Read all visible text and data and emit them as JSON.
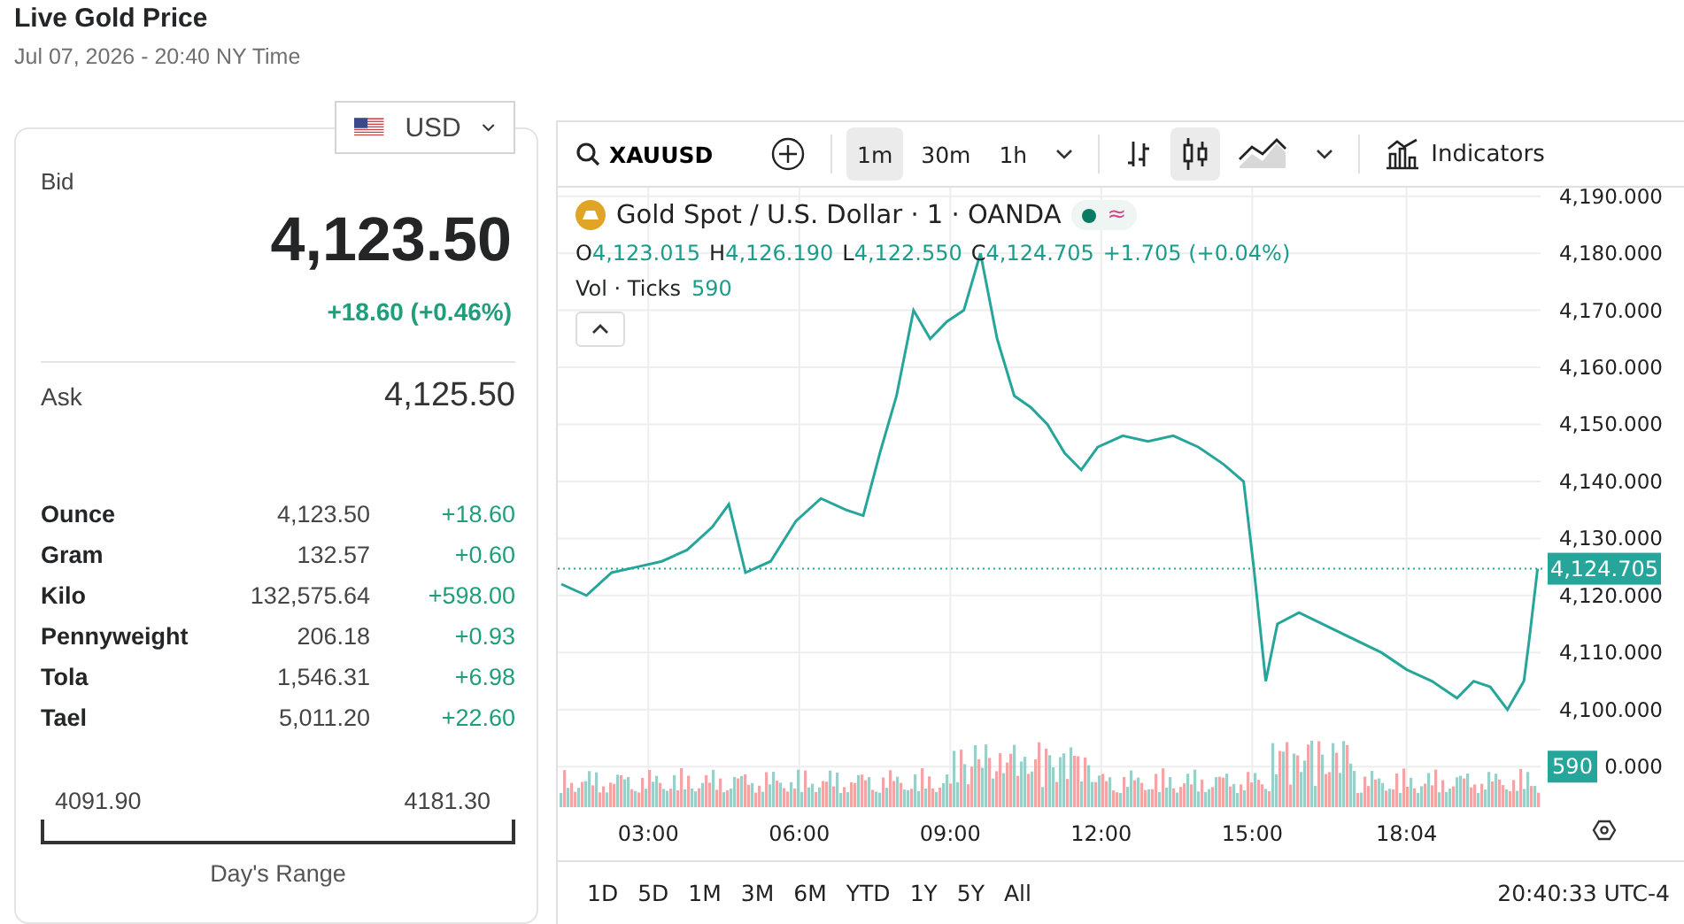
{
  "header": {
    "title": "Live Gold Price",
    "timestamp": "Jul 07, 2026 - 20:40 NY Time"
  },
  "currency": {
    "code": "USD"
  },
  "quote": {
    "bid_label": "Bid",
    "bid": "4,123.50",
    "change": "+18.60 (+0.46%)",
    "ask_label": "Ask",
    "ask": "4,125.50"
  },
  "units": [
    {
      "unit": "Ounce",
      "price": "4,123.50",
      "change": "+18.60"
    },
    {
      "unit": "Gram",
      "price": "132.57",
      "change": "+0.60"
    },
    {
      "unit": "Kilo",
      "price": "132,575.64",
      "change": "+598.00"
    },
    {
      "unit": "Pennyweight",
      "price": "206.18",
      "change": "+0.93"
    },
    {
      "unit": "Tola",
      "price": "1,546.31",
      "change": "+6.98"
    },
    {
      "unit": "Tael",
      "price": "5,011.20",
      "change": "+22.60"
    }
  ],
  "day_range": {
    "low": "4091.90",
    "high": "4181.30",
    "label": "Day's Range"
  },
  "chart": {
    "toolbar": {
      "symbol": "XAUUSD",
      "intervals": [
        {
          "label": "1m",
          "selected": true
        },
        {
          "label": "30m",
          "selected": false
        },
        {
          "label": "1h",
          "selected": false
        }
      ],
      "chart_types": [
        {
          "kind": "bars",
          "selected": false
        },
        {
          "kind": "candles",
          "selected": true
        },
        {
          "kind": "area",
          "selected": false
        }
      ],
      "indicators": "Indicators"
    },
    "legend": {
      "title": "Gold Spot / U.S. Dollar · 1 · OANDA",
      "status": "≈",
      "ohlc": [
        {
          "key": "O",
          "value": "4,123.015"
        },
        {
          "key": "H",
          "value": "4,126.190"
        },
        {
          "key": "L",
          "value": "4,122.550"
        },
        {
          "key": "C",
          "value": "4,124.705"
        }
      ],
      "change": "+1.705 (+0.04%)",
      "volume_label": "Vol · Ticks",
      "volume": "590"
    },
    "last_price": "4,124.705",
    "last_volume": "590",
    "covered_tick_label": "0.000",
    "chart_data": {
      "type": "line",
      "grid": true,
      "xlim": [
        1.2,
        20.8
      ],
      "ylim": [
        4082.9,
        4191.5
      ],
      "ref_lines": [
        {
          "axis": "y",
          "value": 4124.705,
          "color": "#26a69a"
        }
      ],
      "xticks": [
        {
          "value": 3,
          "label": "03:00"
        },
        {
          "value": 6,
          "label": "06:00"
        },
        {
          "value": 9,
          "label": "09:00"
        },
        {
          "value": 12,
          "label": "12:00"
        },
        {
          "value": 15,
          "label": "15:00"
        },
        {
          "value": 18.067,
          "label": "18:04"
        }
      ],
      "yticks": [
        {
          "value": 4100,
          "label": "4,100.000"
        },
        {
          "value": 4110,
          "label": "4,110.000"
        },
        {
          "value": 4120,
          "label": "4,120.000"
        },
        {
          "value": 4130,
          "label": "4,130.000"
        },
        {
          "value": 4140,
          "label": "4,140.000"
        },
        {
          "value": 4150,
          "label": "4,150.000"
        },
        {
          "value": 4160,
          "label": "4,160.000"
        },
        {
          "value": 4170,
          "label": "4,170.000"
        },
        {
          "value": 4180,
          "label": "4,180.000"
        },
        {
          "value": 4190,
          "label": "4,190.000"
        }
      ],
      "x": [
        1.27,
        1.77,
        2.27,
        2.77,
        3.27,
        3.77,
        4.27,
        4.6,
        4.93,
        5.43,
        5.93,
        6.43,
        6.93,
        7.27,
        7.6,
        7.93,
        8.27,
        8.6,
        8.93,
        9.27,
        9.6,
        9.93,
        10.27,
        10.6,
        10.93,
        11.27,
        11.6,
        11.93,
        12.43,
        12.93,
        13.43,
        13.93,
        14.43,
        14.83,
        15.03,
        15.27,
        15.5,
        15.93,
        17.57,
        18.07,
        18.57,
        19.07,
        19.4,
        19.73,
        20.07,
        20.4,
        20.5,
        20.67
      ],
      "series": [
        {
          "color": "#26a69a",
          "values": [
            4122,
            4120,
            4124,
            4125,
            4126,
            4128,
            4132,
            4136,
            4124,
            4126,
            4133,
            4137,
            4135,
            4134,
            4145,
            4155,
            4170,
            4165,
            4168,
            4170,
            4180,
            4165,
            4155,
            4153,
            4150,
            4145,
            4142,
            4146,
            4148,
            4147,
            4148,
            4146,
            4143,
            4140,
            4125,
            4105,
            4115,
            4117,
            4110,
            4107,
            4105,
            4102,
            4105,
            4104,
            4100,
            4105,
            4112,
            4124.7
          ]
        }
      ]
    },
    "ranges": [
      {
        "label": "1D"
      },
      {
        "label": "5D"
      },
      {
        "label": "1M"
      },
      {
        "label": "3M"
      },
      {
        "label": "6M"
      },
      {
        "label": "YTD"
      },
      {
        "label": "1Y"
      },
      {
        "label": "5Y"
      },
      {
        "label": "All"
      }
    ],
    "clock": "20:40:33 UTC-4"
  }
}
